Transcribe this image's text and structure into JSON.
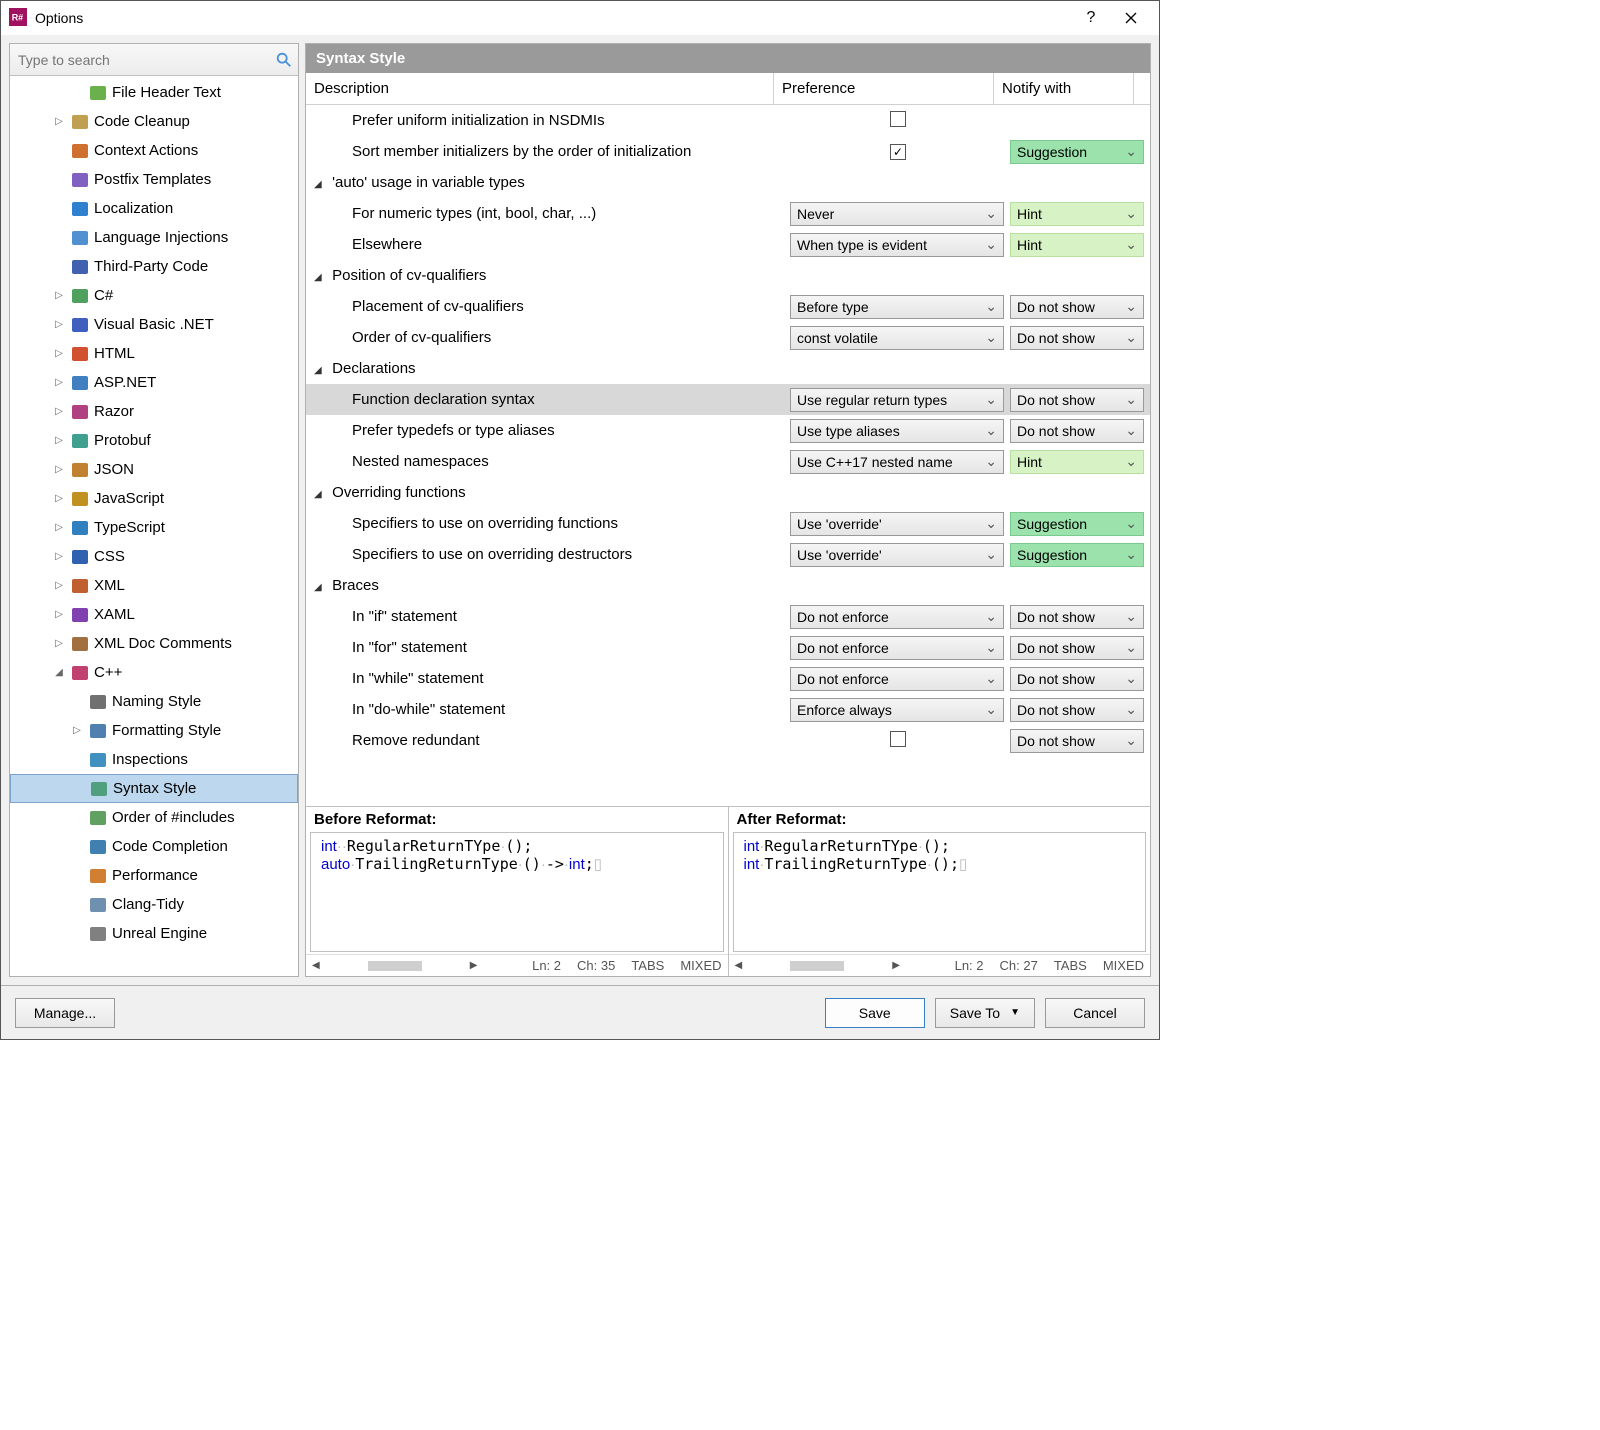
{
  "window": {
    "title": "Options"
  },
  "search": {
    "placeholder": "Type to search"
  },
  "tree": {
    "items": [
      {
        "label": "File Header Text",
        "indent": 2,
        "expander": "",
        "icon": "file-icon"
      },
      {
        "label": "Code Cleanup",
        "indent": 1,
        "expander": "▷",
        "icon": "broom-icon"
      },
      {
        "label": "Context Actions",
        "indent": 1,
        "expander": "",
        "icon": "tool-icon"
      },
      {
        "label": "Postfix Templates",
        "indent": 1,
        "expander": "",
        "icon": "bracket-icon"
      },
      {
        "label": "Localization",
        "indent": 1,
        "expander": "",
        "icon": "globe-icon"
      },
      {
        "label": "Language Injections",
        "indent": 1,
        "expander": "",
        "icon": "inject-icon"
      },
      {
        "label": "Third-Party Code",
        "indent": 1,
        "expander": "",
        "icon": "book-icon"
      },
      {
        "label": "C#",
        "indent": 1,
        "expander": "▷",
        "icon": "csharp-icon"
      },
      {
        "label": "Visual Basic .NET",
        "indent": 1,
        "expander": "▷",
        "icon": "vb-icon"
      },
      {
        "label": "HTML",
        "indent": 1,
        "expander": "▷",
        "icon": "html-icon"
      },
      {
        "label": "ASP.NET",
        "indent": 1,
        "expander": "▷",
        "icon": "asp-icon"
      },
      {
        "label": "Razor",
        "indent": 1,
        "expander": "▷",
        "icon": "razor-icon"
      },
      {
        "label": "Protobuf",
        "indent": 1,
        "expander": "▷",
        "icon": "proto-icon"
      },
      {
        "label": "JSON",
        "indent": 1,
        "expander": "▷",
        "icon": "json-icon"
      },
      {
        "label": "JavaScript",
        "indent": 1,
        "expander": "▷",
        "icon": "js-icon"
      },
      {
        "label": "TypeScript",
        "indent": 1,
        "expander": "▷",
        "icon": "ts-icon"
      },
      {
        "label": "CSS",
        "indent": 1,
        "expander": "▷",
        "icon": "css-icon"
      },
      {
        "label": "XML",
        "indent": 1,
        "expander": "▷",
        "icon": "xml-icon"
      },
      {
        "label": "XAML",
        "indent": 1,
        "expander": "▷",
        "icon": "xaml-icon"
      },
      {
        "label": "XML Doc Comments",
        "indent": 1,
        "expander": "▷",
        "icon": "xmldoc-icon"
      },
      {
        "label": "C++",
        "indent": 1,
        "expander": "◢",
        "icon": "cpp-icon"
      },
      {
        "label": "Naming Style",
        "indent": 2,
        "expander": "",
        "icon": "aa-icon"
      },
      {
        "label": "Formatting Style",
        "indent": 2,
        "expander": "▷",
        "icon": "format-icon"
      },
      {
        "label": "Inspections",
        "indent": 2,
        "expander": "",
        "icon": "inspect-icon"
      },
      {
        "label": "Syntax Style",
        "indent": 2,
        "expander": "",
        "icon": "syntax-icon",
        "selected": true
      },
      {
        "label": "Order of #includes",
        "indent": 2,
        "expander": "",
        "icon": "order-icon"
      },
      {
        "label": "Code Completion",
        "indent": 2,
        "expander": "",
        "icon": "complete-icon"
      },
      {
        "label": "Performance",
        "indent": 2,
        "expander": "",
        "icon": "perf-icon"
      },
      {
        "label": "Clang-Tidy",
        "indent": 2,
        "expander": "",
        "icon": "clang-icon"
      },
      {
        "label": "Unreal Engine",
        "indent": 2,
        "expander": "",
        "icon": "unreal-icon"
      }
    ]
  },
  "panel": {
    "title": "Syntax Style",
    "columns": {
      "description": "Description",
      "preference": "Preference",
      "notify": "Notify with"
    },
    "rows": [
      {
        "type": "item",
        "desc": "Prefer uniform initialization in NSDMIs",
        "pref_kind": "check",
        "checked": false
      },
      {
        "type": "item",
        "desc": "Sort member initializers by the order of initialization",
        "pref_kind": "check",
        "checked": true,
        "notify": "Suggestion",
        "notify_style": "green"
      },
      {
        "type": "group",
        "desc": "'auto' usage in variable types"
      },
      {
        "type": "item",
        "desc": "For numeric types (int, bool, char, ...)",
        "pref_kind": "drop",
        "pref": "Never",
        "notify": "Hint",
        "notify_style": "lightgreen"
      },
      {
        "type": "item",
        "desc": "Elsewhere",
        "pref_kind": "drop",
        "pref": "When type is evident",
        "notify": "Hint",
        "notify_style": "lightgreen"
      },
      {
        "type": "group",
        "desc": "Position of cv-qualifiers"
      },
      {
        "type": "item",
        "desc": "Placement of cv-qualifiers",
        "pref_kind": "drop",
        "pref": "Before type",
        "notify": "Do not show",
        "notify_style": "grey"
      },
      {
        "type": "item",
        "desc": "Order of cv-qualifiers",
        "pref_kind": "drop",
        "pref": "const volatile",
        "notify": "Do not show",
        "notify_style": "grey"
      },
      {
        "type": "group",
        "desc": "Declarations"
      },
      {
        "type": "item",
        "desc": "Function declaration syntax",
        "pref_kind": "drop",
        "pref": "Use regular return types",
        "notify": "Do not show",
        "notify_style": "grey",
        "selected": true
      },
      {
        "type": "item",
        "desc": "Prefer typedefs or type aliases",
        "pref_kind": "drop",
        "pref": "Use type aliases",
        "notify": "Do not show",
        "notify_style": "grey"
      },
      {
        "type": "item",
        "desc": "Nested namespaces",
        "pref_kind": "drop",
        "pref": "Use C++17 nested name",
        "notify": "Hint",
        "notify_style": "lightgreen"
      },
      {
        "type": "group",
        "desc": "Overriding functions"
      },
      {
        "type": "item",
        "desc": "Specifiers to use on overriding functions",
        "pref_kind": "drop",
        "pref": "Use 'override'",
        "notify": "Suggestion",
        "notify_style": "green"
      },
      {
        "type": "item",
        "desc": "Specifiers to use on overriding destructors",
        "pref_kind": "drop",
        "pref": "Use 'override'",
        "notify": "Suggestion",
        "notify_style": "green"
      },
      {
        "type": "group",
        "desc": "Braces"
      },
      {
        "type": "item",
        "desc": "In \"if\" statement",
        "pref_kind": "drop",
        "pref": "Do not enforce",
        "notify": "Do not show",
        "notify_style": "grey"
      },
      {
        "type": "item",
        "desc": "In \"for\" statement",
        "pref_kind": "drop",
        "pref": "Do not enforce",
        "notify": "Do not show",
        "notify_style": "grey"
      },
      {
        "type": "item",
        "desc": "In \"while\" statement",
        "pref_kind": "drop",
        "pref": "Do not enforce",
        "notify": "Do not show",
        "notify_style": "grey"
      },
      {
        "type": "item",
        "desc": "In \"do-while\" statement",
        "pref_kind": "drop",
        "pref": "Enforce always",
        "notify": "Do not show",
        "notify_style": "grey"
      },
      {
        "type": "item",
        "desc": "Remove redundant",
        "pref_kind": "check",
        "checked": false,
        "notify": "Do not show",
        "notify_style": "grey"
      }
    ]
  },
  "preview": {
    "before_title": "Before Reformat:",
    "after_title": "After Reformat:",
    "before_status": {
      "ln": "Ln: 2",
      "ch": "Ch: 35",
      "tabs": "TABS",
      "mixed": "MIXED"
    },
    "after_status": {
      "ln": "Ln: 2",
      "ch": "Ch: 27",
      "tabs": "TABS",
      "mixed": "MIXED"
    },
    "before_code_html": "<span class='kw'>int</span><span class='dot'>··</span>RegularReturnTYpe<span class='dot'>·</span>();\n<span class='kw'>auto</span><span class='dot'>·</span>TrailingReturnType<span class='dot'>·</span>()<span class='dot'>·</span>-&gt;<span class='dot'>·</span><span class='kw'>int</span>;<span class='dot'>▯</span>",
    "after_code_html": "<span class='kw'>int</span><span class='dot'>·</span>RegularReturnTYpe<span class='dot'>·</span>();\n<span class='kw'>int</span><span class='dot'>·</span>TrailingReturnType<span class='dot'>·</span>();<span class='dot'>▯</span>"
  },
  "buttons": {
    "manage": "Manage...",
    "save": "Save",
    "save_to": "Save To",
    "cancel": "Cancel"
  }
}
